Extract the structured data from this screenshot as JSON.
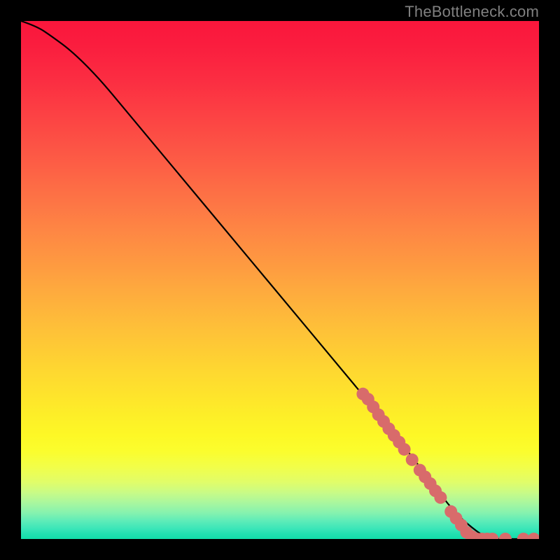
{
  "attribution": "TheBottleneck.com",
  "chart_data": {
    "type": "line",
    "title": "",
    "xlabel": "",
    "ylabel": "",
    "xlim": [
      0,
      100
    ],
    "ylim": [
      0,
      100
    ],
    "curve": {
      "name": "bottleneck-curve",
      "x": [
        0,
        3,
        6,
        10,
        15,
        20,
        30,
        40,
        50,
        60,
        70,
        80,
        83,
        86,
        90,
        95,
        100
      ],
      "y": [
        100,
        99,
        97,
        94,
        89,
        83,
        71,
        59,
        47,
        35,
        23,
        10,
        6,
        3,
        0,
        0,
        0
      ]
    },
    "points": {
      "name": "marker-dots",
      "color": "#d86b6b",
      "x": [
        66,
        67,
        68,
        69,
        70,
        71,
        72,
        73,
        74,
        75.5,
        77,
        78,
        79,
        80,
        81,
        83,
        84,
        85,
        86,
        87,
        88,
        89,
        90,
        91,
        93.5,
        97,
        99
      ],
      "y": [
        28,
        27,
        25.5,
        24,
        22.7,
        21.3,
        20,
        18.7,
        17.3,
        15.3,
        13.3,
        12,
        10.7,
        9.3,
        8,
        5.3,
        4,
        2.7,
        1.3,
        0.5,
        0,
        0,
        0,
        0,
        0,
        0,
        0
      ]
    },
    "background_gradient": {
      "stops": [
        {
          "offset": 0.0,
          "color": "#fa163c"
        },
        {
          "offset": 0.04,
          "color": "#fa1c3e"
        },
        {
          "offset": 0.08,
          "color": "#fb2540"
        },
        {
          "offset": 0.12,
          "color": "#fb2f42"
        },
        {
          "offset": 0.16,
          "color": "#fc3b43"
        },
        {
          "offset": 0.2,
          "color": "#fc4744"
        },
        {
          "offset": 0.24,
          "color": "#fc5345"
        },
        {
          "offset": 0.28,
          "color": "#fd5f45"
        },
        {
          "offset": 0.32,
          "color": "#fd6c45"
        },
        {
          "offset": 0.36,
          "color": "#fd7845"
        },
        {
          "offset": 0.4,
          "color": "#fe8544"
        },
        {
          "offset": 0.44,
          "color": "#fe9142"
        },
        {
          "offset": 0.48,
          "color": "#fe9d40"
        },
        {
          "offset": 0.52,
          "color": "#feaa3e"
        },
        {
          "offset": 0.56,
          "color": "#feb63b"
        },
        {
          "offset": 0.6,
          "color": "#fec238"
        },
        {
          "offset": 0.64,
          "color": "#fecd34"
        },
        {
          "offset": 0.68,
          "color": "#fed930"
        },
        {
          "offset": 0.72,
          "color": "#fee32c"
        },
        {
          "offset": 0.76,
          "color": "#fdee28"
        },
        {
          "offset": 0.8,
          "color": "#fdf826"
        },
        {
          "offset": 0.83,
          "color": "#fbfd2d"
        },
        {
          "offset": 0.86,
          "color": "#f2fe48"
        },
        {
          "offset": 0.89,
          "color": "#e1fd69"
        },
        {
          "offset": 0.91,
          "color": "#c9fb86"
        },
        {
          "offset": 0.93,
          "color": "#a9f79e"
        },
        {
          "offset": 0.95,
          "color": "#84f2af"
        },
        {
          "offset": 0.965,
          "color": "#5eecb8"
        },
        {
          "offset": 0.98,
          "color": "#3be6b8"
        },
        {
          "offset": 0.99,
          "color": "#22e1b1"
        },
        {
          "offset": 1.0,
          "color": "#12dda9"
        }
      ]
    }
  }
}
